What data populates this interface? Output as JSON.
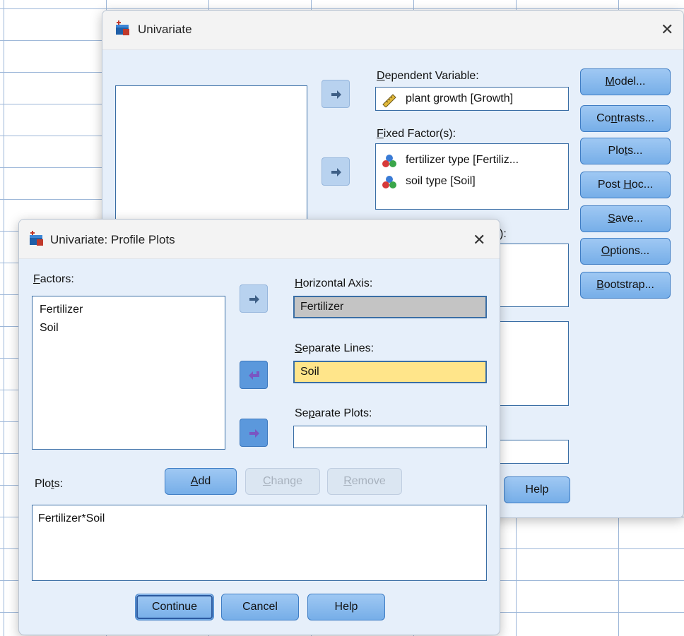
{
  "univariate": {
    "title": "Univariate",
    "dependent_label_first": "D",
    "dependent_label_rest": "ependent Variable:",
    "dependent_value": "plant growth [Growth]",
    "fixed_label_first": "F",
    "fixed_label_rest": "ixed Factor(s):",
    "fixed_items": [
      "fertilizer type [Fertiliz...",
      "soil type [Soil]"
    ],
    "hidden_label_fragment": "):",
    "side_buttons": [
      {
        "pre": "",
        "u": "M",
        "post": "odel..."
      },
      {
        "pre": "Co",
        "u": "n",
        "post": "trasts..."
      },
      {
        "pre": "Plo",
        "u": "t",
        "post": "s..."
      },
      {
        "pre": "Post ",
        "u": "H",
        "post": "oc..."
      },
      {
        "pre": "",
        "u": "S",
        "post": "ave..."
      },
      {
        "pre": "",
        "u": "O",
        "post": "ptions..."
      },
      {
        "pre": "",
        "u": "B",
        "post": "ootstrap..."
      }
    ],
    "help_label": "Help"
  },
  "profile_plots": {
    "title": "Univariate: Profile Plots",
    "factors_label_first": "F",
    "factors_label_rest": "actors:",
    "factors": [
      "Fertilizer",
      "Soil"
    ],
    "horizontal_label_first": "H",
    "horizontal_label_rest": "orizontal Axis:",
    "horizontal_value": "Fertilizer",
    "separate_lines_label_first": "S",
    "separate_lines_label_rest": "eparate Lines:",
    "separate_lines_value": "Soil",
    "separate_plots_label_pre": "Se",
    "separate_plots_label_u": "p",
    "separate_plots_label_post": "arate Plots:",
    "separate_plots_value": "",
    "plots_label_pre": "Plo",
    "plots_label_u": "t",
    "plots_label_post": "s:",
    "add_u": "A",
    "add_rest": "dd",
    "change_u": "C",
    "change_rest": "hange",
    "remove_u": "R",
    "remove_rest": "emove",
    "plots_items": [
      "Fertilizer*Soil"
    ],
    "continue_label": "Continue",
    "cancel_label": "Cancel",
    "help_label": "Help"
  },
  "colors": {
    "dialog_bg": "#e6effa",
    "button": "#8dbdee",
    "highlight": "#ffe58a",
    "selection_gray": "#c4c4c4"
  },
  "icons": {
    "app": "spss-app-icon",
    "scale": "ruler-scale-icon",
    "nominal": "nominal-factor-icon",
    "arrow_right": "arrow-right-icon",
    "arrow_left": "arrow-left-icon"
  }
}
